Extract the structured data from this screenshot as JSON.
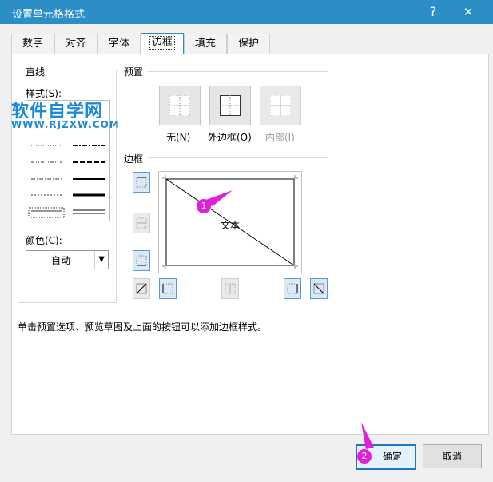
{
  "title": "设置单元格格式",
  "titlebar": {
    "help": "?",
    "close": "✕"
  },
  "tabs": [
    {
      "label": "数字"
    },
    {
      "label": "对齐"
    },
    {
      "label": "字体"
    },
    {
      "label": "边框",
      "active": true
    },
    {
      "label": "填充"
    },
    {
      "label": "保护"
    }
  ],
  "line_section": {
    "heading": "直线",
    "style_label": "样式(S):",
    "color_label": "颜色(C):",
    "color_value": "自动"
  },
  "presets_section": {
    "heading": "预置",
    "items": [
      {
        "label": "无(N)",
        "state": "enabled"
      },
      {
        "label": "外边框(O)",
        "state": "enabled"
      },
      {
        "label": "内部(I)",
        "state": "disabled"
      }
    ]
  },
  "border_section": {
    "heading": "边框",
    "preview_text": "文本"
  },
  "hint": "单击预置选项、预览草图及上面的按钮可以添加边框样式。",
  "buttons": {
    "ok": "确定",
    "cancel": "取消"
  },
  "watermark": {
    "main": "软件自学网",
    "url": "WWW.RJZXW.COM"
  },
  "annotations": [
    {
      "number": "1"
    },
    {
      "number": "2"
    }
  ],
  "colors": {
    "accent": "#2b8ec5",
    "annotation": "#e11fd6",
    "watermark": "#1e8ad6"
  }
}
